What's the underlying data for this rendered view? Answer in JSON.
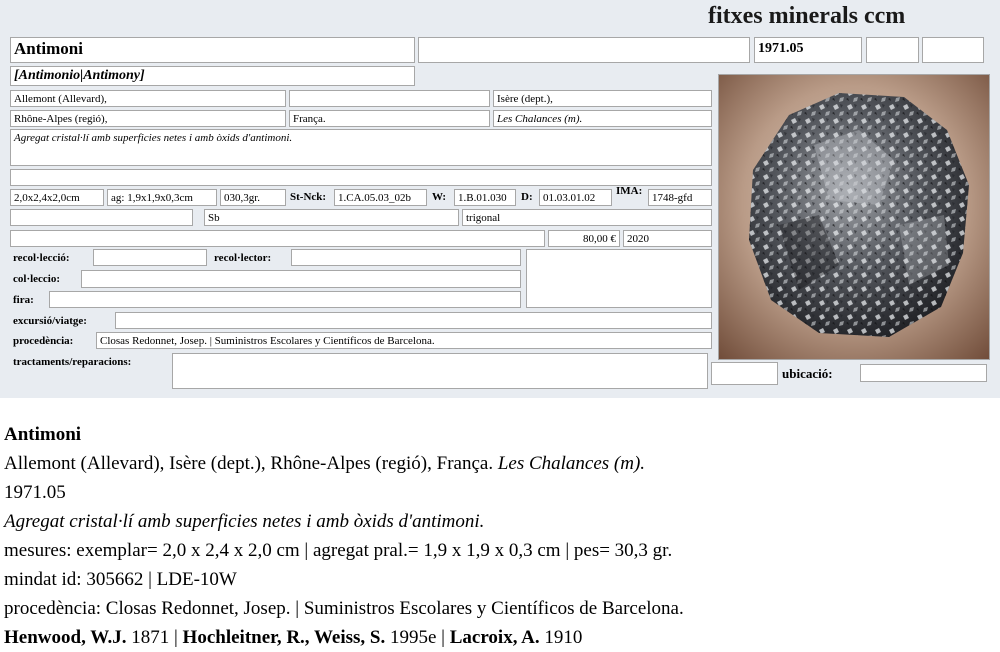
{
  "brand": "fitxes minerals ccm",
  "card": {
    "name": "Antimoni",
    "alt_field": "",
    "code": "1971.05",
    "code_extra1": "",
    "code_extra2": "",
    "synonyms": "[Antimonio|Antimony]",
    "locality": {
      "site": "Allemont (Allevard),",
      "site2": "",
      "dept": "Isère (dept.),",
      "region": "Rhône-Alpes (regió),",
      "country": "França.",
      "mine": "Les Chalances (m)."
    },
    "description": "Agregat cristal·lí amb superficies netes i amb òxids d'antimoni.",
    "blank_row": "",
    "measures": {
      "specimen": "2,0x2,4x2,0cm",
      "aggregate": "ag: 1,9x1,9x0,3cm",
      "weight": "030,3gr.",
      "stnck_label": "St-Nck:",
      "stnck": "1.CA.05.03_02b",
      "w_label": "W:",
      "w": "1.B.01.030",
      "d_label": "D:",
      "d": "01.03.01.02",
      "ima_label": "IMA:",
      "ima": "1748-gfd"
    },
    "chem_blank": "",
    "formula": "Sb",
    "system": "trigonal",
    "price_note": "",
    "price": "80,00 €",
    "year": "2020",
    "labels": {
      "recollection": "recol·lecció:",
      "collector": "recol·lector:",
      "collection": "col·leccio:",
      "fair": "fira:",
      "trip": "excursió/viatge:",
      "provenance": "procedència:",
      "treatments": "tractaments/reparacions:",
      "location": "ubicació:"
    },
    "values": {
      "recollection": "",
      "collector": "",
      "collection": "",
      "fair": "",
      "trip": "",
      "provenance": "Closas Redonnet, Josep. | Suministros Escolares y Científicos de Barcelona.",
      "treatments": "",
      "location_pre": "",
      "location": ""
    }
  },
  "summary": {
    "name": "Antimoni",
    "locality": "Allemont (Allevard), Isère (dept.), Rhône-Alpes (regió), França.",
    "mine": "Les Chalances (m).",
    "code": "1971.05",
    "description": "Agregat cristal·lí amb superficies netes i amb òxids d'antimoni.",
    "measures": "mesures: exemplar= 2,0 x 2,4 x 2,0 cm | agregat pral.= 1,9 x 1,9 x 0,3 cm | pes= 30,3 gr.",
    "ids": "mindat id: 305662 | LDE-10W",
    "provenance": "procedència: Closas Redonnet, Josep. | Suministros Escolares y Científicos de Barcelona.",
    "references": [
      {
        "author": "Henwood, W.J.",
        "year": "1871"
      },
      {
        "author": "Hochleitner, R., Weiss, S.",
        "year": "1995e"
      },
      {
        "author": "Lacroix, A.",
        "year": "1910"
      }
    ]
  }
}
